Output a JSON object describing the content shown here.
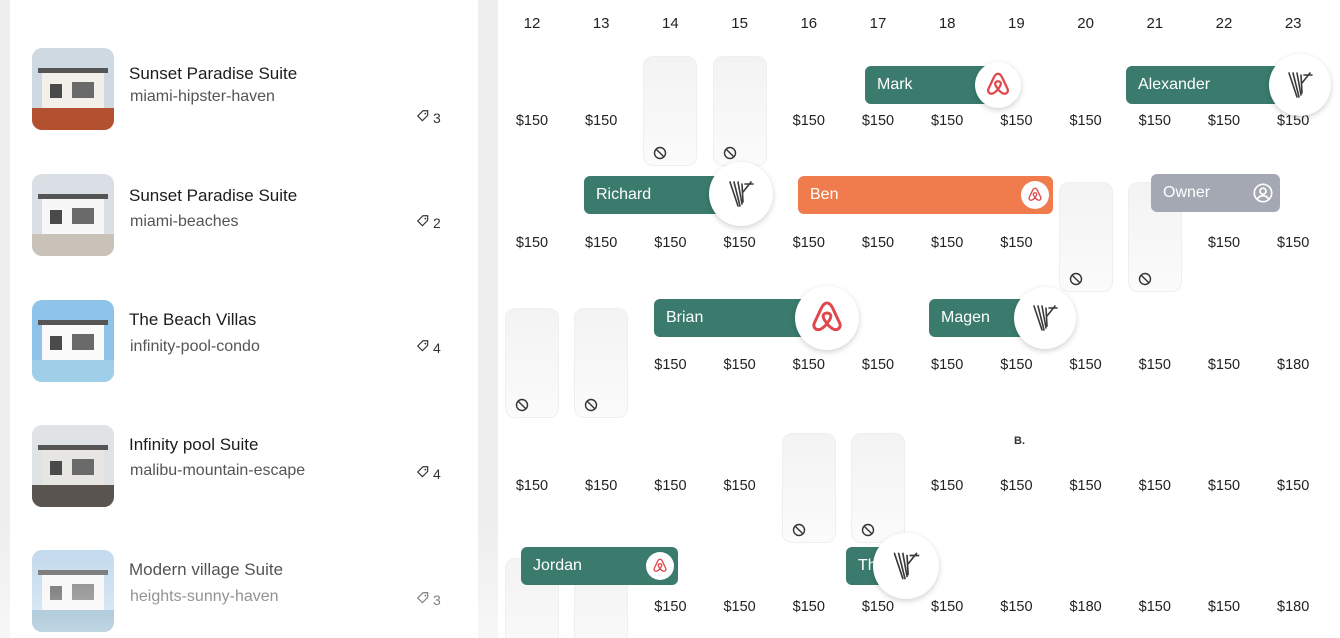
{
  "properties": [
    {
      "name": "Sunset Paradise Suite",
      "slug": "miami-hipster-haven",
      "count": "3",
      "thumb_icon": "house-thumbnail"
    },
    {
      "name": "Sunset Paradise Suite",
      "slug": "miami-beaches",
      "count": "2",
      "thumb_icon": "house-thumbnail"
    },
    {
      "name": "The Beach Villas",
      "slug": "infinity-pool-condo",
      "count": "4",
      "thumb_icon": "house-thumbnail"
    },
    {
      "name": "Infinity pool Suite",
      "slug": "malibu-mountain-escape",
      "count": "4",
      "thumb_icon": "house-thumbnail"
    },
    {
      "name": "Modern village Suite",
      "slug": "heights-sunny-haven",
      "count": "3",
      "thumb_icon": "house-thumbnail"
    }
  ],
  "days": [
    "12",
    "13",
    "14",
    "15",
    "16",
    "17",
    "18",
    "19",
    "20",
    "21",
    "22",
    "23"
  ],
  "prices": [
    [
      "$150",
      "$150",
      "",
      "",
      "$150",
      "$150",
      "$150",
      "$150",
      "$150",
      "$150",
      "$150",
      "$150"
    ],
    [
      "$150",
      "$150",
      "$150",
      "$150",
      "$150",
      "$150",
      "$150",
      "$150",
      "",
      "",
      "$150",
      "$150"
    ],
    [
      "",
      "",
      "$150",
      "$150",
      "$150",
      "$150",
      "$150",
      "$150",
      "$150",
      "$150",
      "$150",
      "$180"
    ],
    [
      "$150",
      "$150",
      "$150",
      "$150",
      "",
      "",
      "$150",
      "$150",
      "$150",
      "$150",
      "$150",
      "$150"
    ],
    [
      "",
      "",
      "$150",
      "$150",
      "$150",
      "$150",
      "$150",
      "$150",
      "$180",
      "$150",
      "$150",
      "$180"
    ]
  ],
  "blocked": [
    [
      0,
      2
    ],
    [
      0,
      3
    ],
    [
      1,
      8
    ],
    [
      1,
      9
    ],
    [
      2,
      0
    ],
    [
      2,
      1
    ],
    [
      3,
      4
    ],
    [
      3,
      5
    ],
    [
      4,
      0
    ],
    [
      4,
      1
    ]
  ],
  "reservations": [
    {
      "guest": "Mark",
      "row": 0,
      "start": 5,
      "end": 7,
      "color": "teal",
      "channel": "airbnb-icon"
    },
    {
      "guest": "Alexander",
      "row": 0,
      "start": 9,
      "end": 11,
      "color": "teal",
      "channel": "vrbo-icon"
    },
    {
      "guest": "Richard",
      "row": 1,
      "start": 1,
      "end": 3,
      "color": "teal",
      "channel": "vrbo-icon"
    },
    {
      "guest": "Ben",
      "row": 1,
      "start": 4,
      "end": 7,
      "color": "orange",
      "channel": "airbnb-icon"
    },
    {
      "guest": "Owner",
      "row": 1,
      "start": 9,
      "end": 10,
      "color": "gray",
      "channel": "owner-icon"
    },
    {
      "guest": "Brian",
      "row": 2,
      "start": 2,
      "end": 4,
      "color": "teal",
      "channel": "airbnb-icon"
    },
    {
      "guest": "Magen",
      "row": 2,
      "start": 6,
      "end": 7,
      "color": "teal",
      "channel": "vrbo-icon"
    },
    {
      "guest": "Jordan",
      "row": 4,
      "start": 0,
      "end": 2,
      "color": "teal",
      "channel": "airbnb-icon"
    },
    {
      "guest": "Th",
      "row": 4,
      "start": 5,
      "end": 5,
      "color": "teal",
      "channel": "vrbo-icon"
    }
  ],
  "marker": "B.",
  "colors": {
    "teal": "#3a7b6e",
    "orange": "#f07c4d",
    "gray": "#a4a8b3",
    "airbnb": "#e0484d"
  }
}
